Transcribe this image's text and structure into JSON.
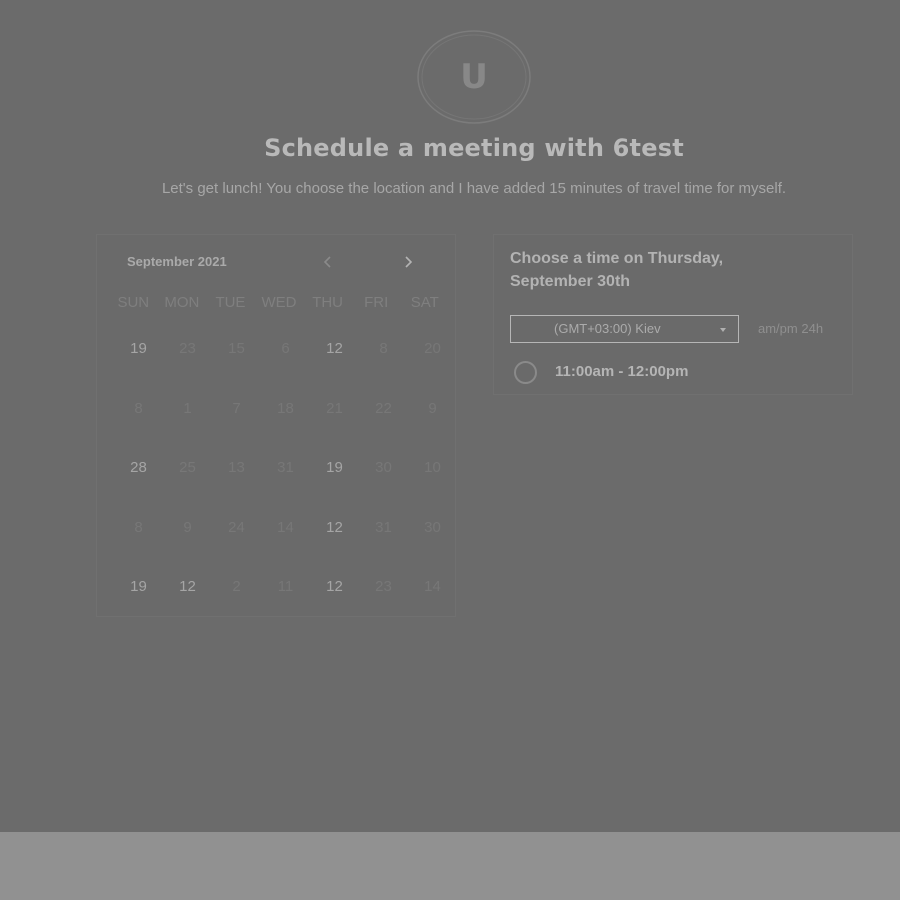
{
  "header": {
    "avatar_letter": "U",
    "title": "Schedule a meeting with 6test",
    "subtitle": "Let's get lunch! You choose the location and I have added 15 minutes of travel time for myself."
  },
  "calendar": {
    "month_label": "September 2021",
    "prev_icon": "chevron-left-icon",
    "next_icon": "chevron-right-icon",
    "weekdays": [
      "SUN",
      "MON",
      "TUE",
      "WED",
      "THU",
      "FRI",
      "SAT"
    ],
    "rows": [
      [
        "19",
        "23",
        "15",
        "6",
        "12",
        "8",
        "20"
      ],
      [
        "8",
        "1",
        "7",
        "18",
        "21",
        "22",
        "9"
      ],
      [
        "28",
        "25",
        "13",
        "31",
        "19",
        "30",
        "10"
      ],
      [
        "8",
        "9",
        "24",
        "14",
        "12",
        "31",
        "30"
      ],
      [
        "19",
        "12",
        "2",
        "11",
        "12",
        "23",
        "14"
      ]
    ]
  },
  "time_panel": {
    "heading": "Choose a time on Thursday, September 30th",
    "timezone": "(GMT+03:00) Kiev",
    "format_ampm": "am/pm",
    "format_24h": "24h",
    "slot": "11:00am - 12:00pm"
  }
}
